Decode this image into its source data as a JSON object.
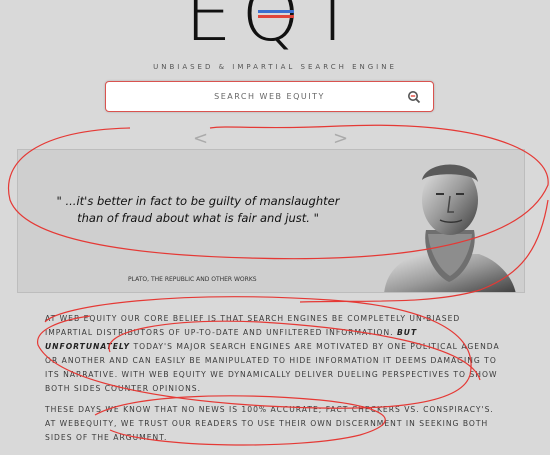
{
  "logo": {
    "text": "EQT",
    "tagline": "UNBIASED & IMPARTIAL SEARCH ENGINE"
  },
  "search": {
    "placeholder": "SEARCH WEB EQUITY",
    "icon": "search-icon"
  },
  "carousel": {
    "prev": "<",
    "next": ">",
    "quote": "\" ...it's better in fact to be guilty of manslaughter than of fraud about what is fair and just. \"",
    "source": "PLATO, THE REPUBLIC AND OTHER WORKS",
    "image": "plato-bust"
  },
  "about": {
    "p1_start": "AT WEB EQUITY OUR CORE BELIEF IS THAT SEARCH ENGINES BE COMPLETELY UN-BIASED IMPARTIAL DISTRIBUTORS OF UP-TO-DATE AND UNFILTERED INFORMATION. ",
    "p1_emphasis": "BUT UNFORTUNATELY",
    "p1_end": " TODAY'S MAJOR SEARCH ENGINES ARE MOTIVATED BY ONE POLITICAL AGENDA OR ANOTHER AND CAN EASILY BE MANIPULATED TO HIDE INFORMATION IT DEEMS DAMAGING TO ITS NARRATIVE. WITH WEB EQUITY WE DYNAMICALLY DELIVER DUELING PERSPECTIVES TO SHOW BOTH SIDES COUNTER OPINIONS.",
    "p2": "THESE DAYS WE KNOW THAT NO NEWS IS 100% ACCURATE; FACT CHECKERS VS. CONSPIRACY'S. AT WEBEQUITY, WE TRUST OUR READERS TO USE THEIR OWN DISCERNMENT IN SEEKING BOTH SIDES OF THE ARGUMENT."
  },
  "colors": {
    "background": "#d9d9d9",
    "search_border": "#d9534f",
    "annotation": "#e53935",
    "logo_blue": "#3b6fd0",
    "logo_red": "#e0463c"
  }
}
